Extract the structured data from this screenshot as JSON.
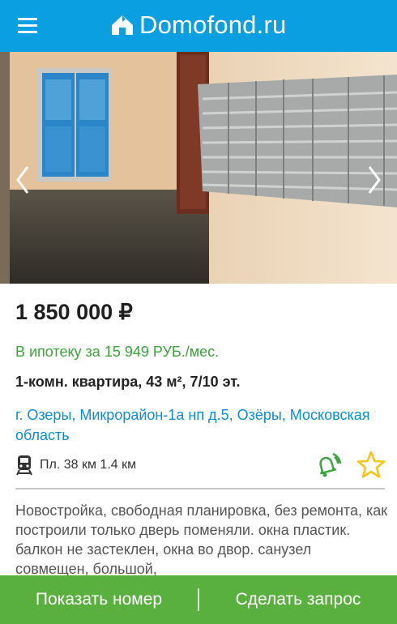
{
  "header": {
    "logo_text": "Domofond.ru",
    "menu_icon": "hamburger-menu-icon",
    "logo_icon": "house-logo-icon",
    "background_color": "#0a9fe0"
  },
  "gallery": {
    "prev_icon": "chevron-left-icon",
    "next_icon": "chevron-right-icon"
  },
  "listing": {
    "price": "1 850 000 ₽",
    "mortgage": "В ипотеку за 15 949 РУБ./мес.",
    "details": "1-комн. квартира, 43 м², 7/10 эт.",
    "address": "г. Озеры, Микрорайон-1а нп д.5, Озёры, Московская область",
    "transport_icon": "train-icon",
    "transport": "Пл. 38 км 1.4 км",
    "notify_icon": "bell-alert-icon",
    "favorite_icon": "star-icon",
    "description": "Новостройка, свободная планировка, без ремонта, как построили только дверь поменяли. окна пластик. балкон не застеклен, окна во двор. санузел совмещен, большой,"
  },
  "colors": {
    "accent_blue": "#0a9fe0",
    "mortgage_green": "#3aa53a",
    "action_green": "#5ab03f",
    "star_yellow": "#f5c518"
  },
  "actions": {
    "show_number": "Показать номер",
    "make_request": "Сделать запрос"
  }
}
